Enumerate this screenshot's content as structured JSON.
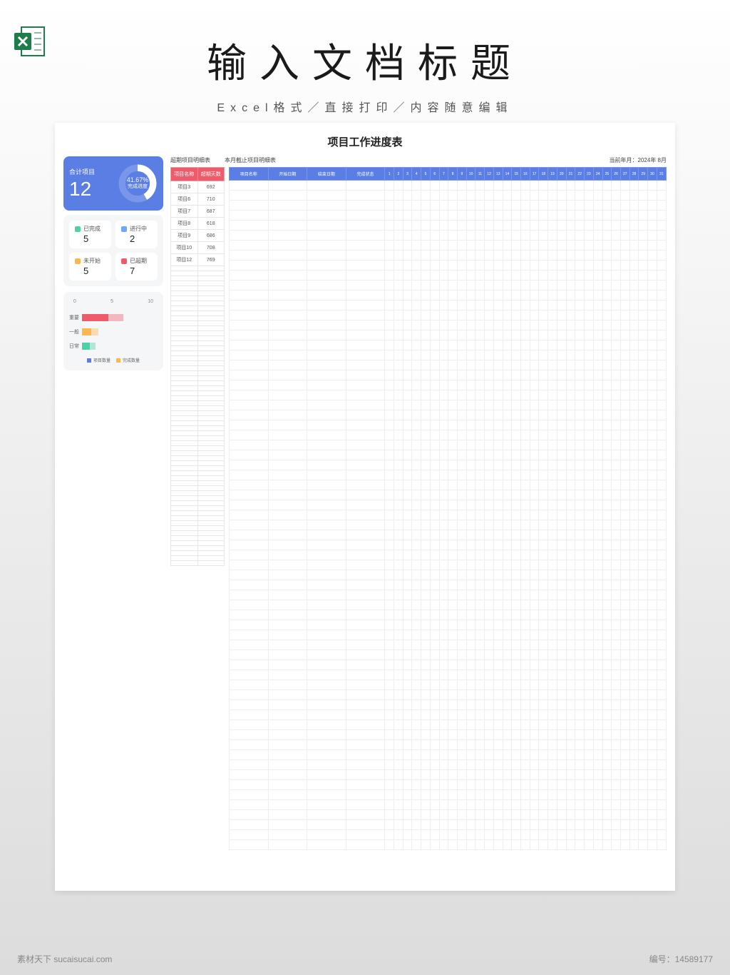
{
  "header": {
    "title": "输入文档标题",
    "subtitle": "Excel格式／直接打印／内容随意编辑"
  },
  "doc": {
    "title": "项目工作进度表",
    "summary": {
      "total_label": "合计项目",
      "total_value": "12",
      "donut_pct": "41.67%",
      "donut_label": "完成进度"
    },
    "stats": [
      {
        "label": "已完成",
        "value": "5",
        "color": "#4cd2a8"
      },
      {
        "label": "进行中",
        "value": "2",
        "color": "#6aa9ff"
      },
      {
        "label": "未开始",
        "value": "5",
        "color": "#ffb74d"
      },
      {
        "label": "已超期",
        "value": "7",
        "color": "#ef5b6b"
      }
    ],
    "mini_chart": {
      "axis": [
        "0",
        "5",
        "10"
      ],
      "rows": [
        {
          "label": "重要",
          "v1": 35,
          "v2": 55,
          "color": "#ef5b6b"
        },
        {
          "label": "一般",
          "v1": 12,
          "v2": 22,
          "color": "#ffb74d"
        },
        {
          "label": "日常",
          "v1": 10,
          "v2": 18,
          "color": "#4cd2a8"
        }
      ],
      "legend": [
        {
          "label": "项目数量",
          "color": "#5b7ee5"
        },
        {
          "label": "完成数量",
          "color": "#ffb74d"
        }
      ]
    },
    "sec_overdue": "超期项目明细表",
    "sec_month": "本月截止项目明细表",
    "sec_date_label": "当前年月：",
    "sec_date_value": "2024年 8月",
    "overdue_cols": [
      "项目名称",
      "超期天数"
    ],
    "overdue_rows": [
      {
        "name": "项目3",
        "days": "692"
      },
      {
        "name": "项目6",
        "days": "710"
      },
      {
        "name": "项目7",
        "days": "687"
      },
      {
        "name": "项目8",
        "days": "618"
      },
      {
        "name": "项目9",
        "days": "686"
      },
      {
        "name": "项目10",
        "days": "708"
      },
      {
        "name": "项目12",
        "days": "769"
      }
    ],
    "detail_cols": [
      "项目名称",
      "开始日期",
      "结束日期",
      "完成状态"
    ],
    "days": [
      "1",
      "2",
      "3",
      "4",
      "5",
      "6",
      "7",
      "8",
      "9",
      "10",
      "11",
      "12",
      "13",
      "14",
      "15",
      "16",
      "17",
      "18",
      "19",
      "20",
      "21",
      "22",
      "23",
      "24",
      "25",
      "26",
      "27",
      "28",
      "29",
      "30",
      "31"
    ]
  },
  "chart_data": {
    "type": "bar",
    "categories": [
      "重要",
      "一般",
      "日常"
    ],
    "series": [
      {
        "name": "项目数量",
        "values": [
          5,
          1.5,
          1.2
        ]
      },
      {
        "name": "完成数量",
        "values": [
          7.5,
          2.8,
          2.2
        ]
      }
    ],
    "xlim": [
      0,
      10
    ],
    "ticks": [
      0,
      5,
      10
    ],
    "orientation": "horizontal",
    "donut": {
      "title": "完成进度",
      "percent": 41.67
    }
  },
  "footer": {
    "left": "素材天下 sucaisucai.com",
    "right_label": "编号：",
    "right_value": "14589177"
  }
}
